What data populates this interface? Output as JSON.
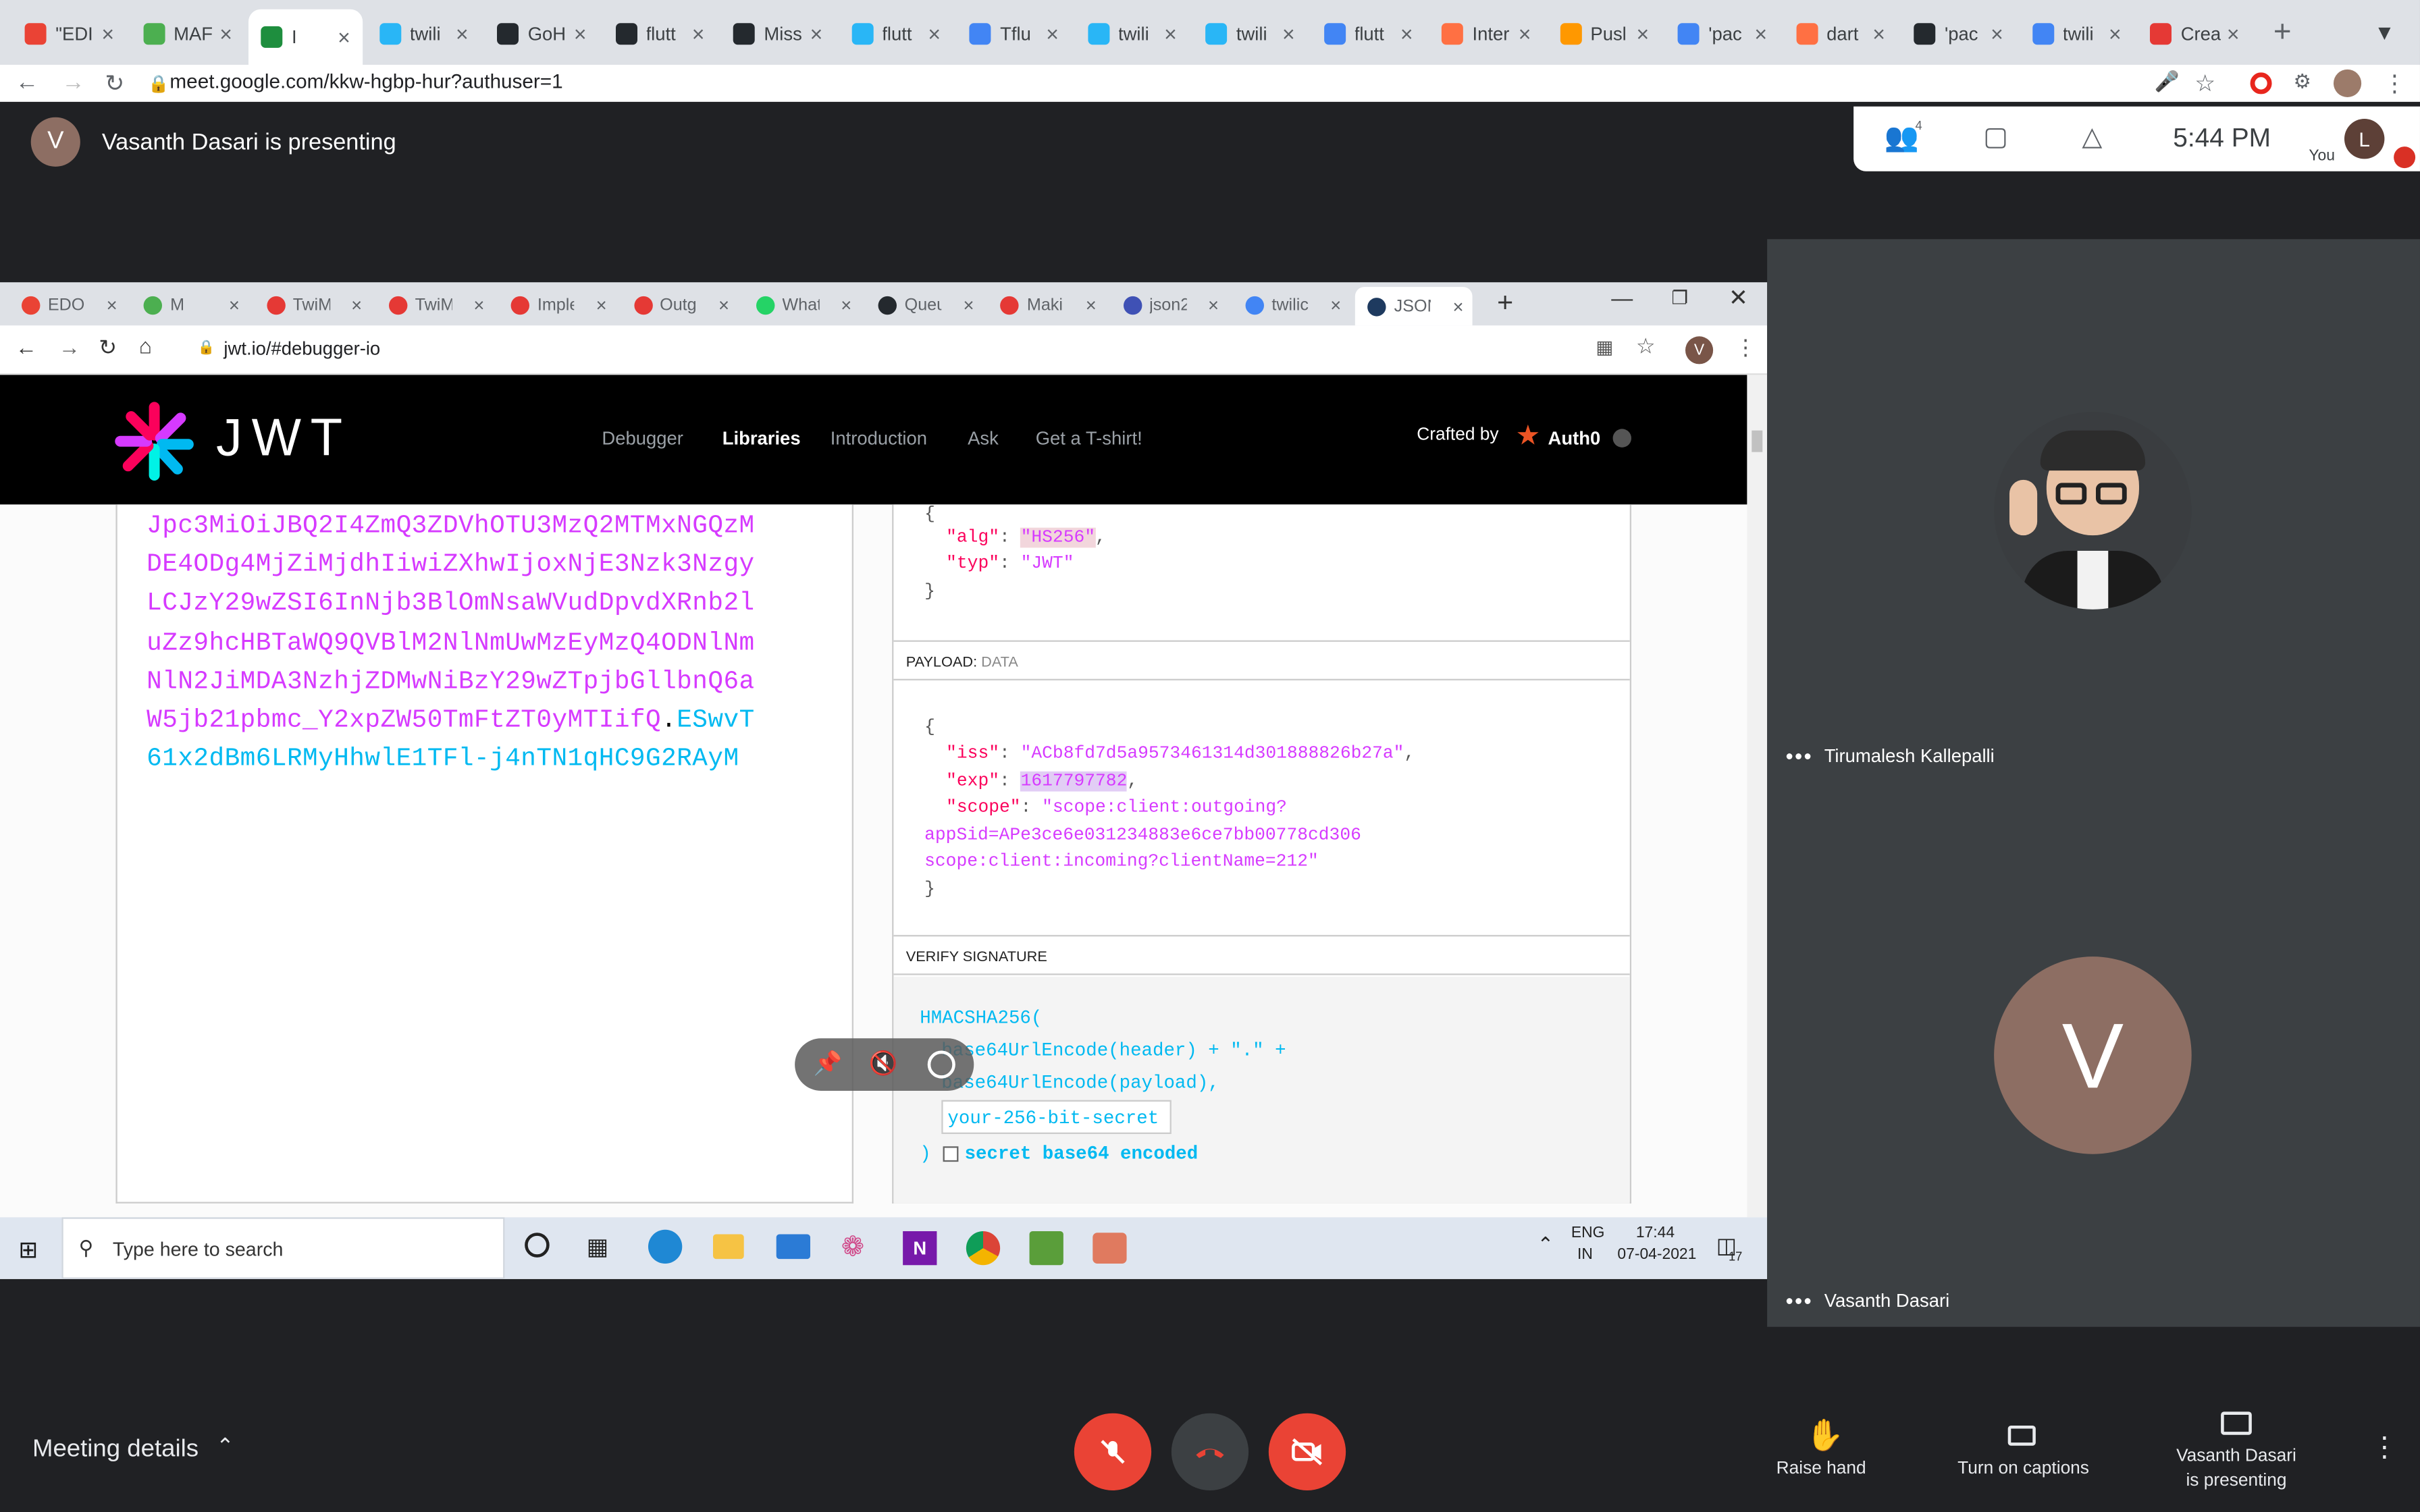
{
  "outer_browser": {
    "tabs": [
      "\"EDI",
      "MAF",
      "I",
      "twili",
      "GoH",
      "flutt",
      "Miss",
      "flutt",
      "Tflu",
      "twili",
      "twili",
      "flutt",
      "Inter",
      "Pusl",
      "'pac",
      "dart",
      "'pac",
      "twili",
      "Crea"
    ],
    "url": "meet.google.com/kkw-hgbp-hur?authuser=1"
  },
  "meet": {
    "presenter_initial": "V",
    "presenting_text": "Vasanth Dasari is presenting",
    "participant_count": "4",
    "time": "5:44 PM",
    "you_label": "You",
    "you_initial": "L",
    "participants": [
      {
        "name": "Tirumalesh Kallepalli"
      },
      {
        "name": "Vasanth Dasari",
        "initial": "V"
      }
    ],
    "meeting_details": "Meeting details",
    "raise_hand": "Raise hand",
    "captions": "Turn on captions",
    "present_line1": "Vasanth Dasari",
    "present_line2": "is presenting"
  },
  "shared": {
    "tabs": [
      "EDO",
      "M",
      "TwiM",
      "TwiM",
      "Imple",
      "Outg",
      "What",
      "Queu",
      "Makir",
      "json2",
      "twilic",
      "JSON"
    ],
    "url": "jwt.io/#debugger-io",
    "profile_initial": "V",
    "logo": "JWT",
    "nav": [
      "Debugger",
      "Libraries",
      "Introduction",
      "Ask",
      "Get a T-shirt!"
    ],
    "crafted_by": "Crafted by",
    "auth0": "Auth0",
    "encoded_lines": [
      "Jpc3MiOiJBQ2I4ZmQ3ZDVhOTU3MzQ2MTMxNGQzM",
      "DE4ODg4MjZiMjdhIiwiZXhwIjoxNjE3Nzk3Nzgy",
      "LCJzY29wZSI6InNjb3BlOmNsaWVudDpvdXRnb2l",
      "uZz9hcHBTaWQ9QVBlM2NlNmUwMzEyMzQ4ODNlNm",
      "NlN2JiMDA3NzhjZDMwNiBzY29wZTpjbGllbnQ6a",
      "W5jb21pbmc_Y2xpZW50TmFtZT0yMTIifQ"
    ],
    "encoded_dot": ".",
    "encoded_sig1": "ESwvT",
    "encoded_sig2": "61x2dBm6LRMyHhwlE1TFl-j4nTN1qHC9G2RAyM",
    "header_json": {
      "alg_key": "\"alg\"",
      "alg": "\"HS256\"",
      "typ_key": "\"typ\"",
      "typ": "\"JWT\""
    },
    "payload_label": "PAYLOAD:",
    "payload_sub": "DATA",
    "payload": {
      "iss_key": "\"iss\"",
      "iss": "\"ACb8fd7d5a9573461314d301888826b27a\"",
      "exp_key": "\"exp\"",
      "exp": "1617797782",
      "scope_key": "\"scope\"",
      "scope1": "\"scope:client:outgoing?",
      "scope2": "appSid=APe3ce6e031234883e6ce7bb00778cd306",
      "scope3": "scope:client:incoming?clientName=212\""
    },
    "verify_label": "VERIFY SIGNATURE",
    "hmac1": "HMACSHA256(",
    "hmac2": "base64UrlEncode(header) + \".\" +",
    "hmac3": "base64UrlEncode(payload),",
    "secret_placeholder": "your-256-bit-secret",
    "secret_b64": "secret base64 encoded",
    "taskbar_search": "Type here to search",
    "lang1": "ENG",
    "lang2": "IN",
    "clock_time": "17:44",
    "clock_date": "07-04-2021",
    "notif_count": "17"
  }
}
